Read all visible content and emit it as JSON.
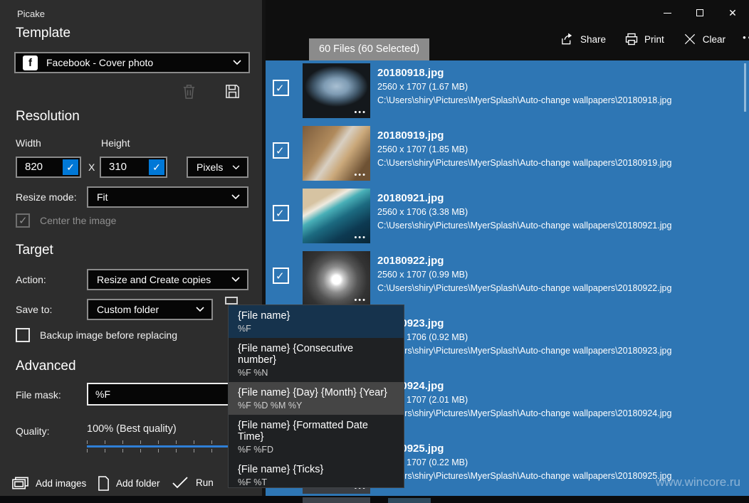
{
  "titlebar": {
    "app_title": "Picake"
  },
  "template_section": {
    "heading": "Template",
    "dropdown_value": "Facebook - Cover photo"
  },
  "resolution_section": {
    "heading": "Resolution",
    "width_label": "Width",
    "height_label": "Height",
    "width_value": "820",
    "height_value": "310",
    "separator": "X",
    "unit_value": "Pixels",
    "resize_mode_label": "Resize mode:",
    "resize_mode_value": "Fit",
    "center_checkbox_label": "Center the image",
    "center_checkbox_checked": true,
    "center_checkbox_disabled": true
  },
  "target_section": {
    "heading": "Target",
    "action_label": "Action:",
    "action_value": "Resize and Create copies",
    "save_to_label": "Save to:",
    "save_to_value": "Custom folder",
    "backup_checkbox_label": "Backup image before replacing",
    "backup_checkbox_checked": false
  },
  "advanced_section": {
    "heading": "Advanced",
    "file_mask_label": "File mask:",
    "file_mask_value": "%F",
    "quality_label": "Quality:",
    "quality_value": "100% (Best quality)"
  },
  "footer": {
    "add_images_label": "Add images",
    "add_folder_label": "Add folder",
    "run_label": "Run"
  },
  "file_mask_menu": {
    "items": [
      {
        "label": "{File name}",
        "code": "%F",
        "state": "selected"
      },
      {
        "label": "{File name} {Consecutive number}",
        "code": "%F %N",
        "state": "normal"
      },
      {
        "label": "{File name} {Day} {Month} {Year}",
        "code": "%F %D %M %Y",
        "state": "hover"
      },
      {
        "label": "{File name} {Formatted Date Time}",
        "code": "%F %FD",
        "state": "normal"
      },
      {
        "label": "{File name} {Ticks}",
        "code": "%F %T",
        "state": "normal"
      }
    ]
  },
  "file_list": {
    "count_badge": "60 Files (60 Selected)",
    "toolbar": {
      "share": "Share",
      "print": "Print",
      "clear": "Clear",
      "more": "•••"
    },
    "rows": [
      {
        "name": "20180918.jpg",
        "meta": "2560 x 1707 (1.67 MB)",
        "path": "C:\\Users\\shiry\\Pictures\\MyerSplash\\Auto-change wallpapers\\20180918.jpg",
        "thumb": "cave",
        "checked": true
      },
      {
        "name": "20180919.jpg",
        "meta": "2560 x 1707 (1.85 MB)",
        "path": "C:\\Users\\shiry\\Pictures\\MyerSplash\\Auto-change wallpapers\\20180919.jpg",
        "thumb": "desk",
        "checked": true
      },
      {
        "name": "20180921.jpg",
        "meta": "2560 x 1706 (3.38 MB)",
        "path": "C:\\Users\\shiry\\Pictures\\MyerSplash\\Auto-change wallpapers\\20180921.jpg",
        "thumb": "beach",
        "checked": true
      },
      {
        "name": "20180922.jpg",
        "meta": "2560 x 1707 (0.99 MB)",
        "path": "C:\\Users\\shiry\\Pictures\\MyerSplash\\Auto-change wallpapers\\20180922.jpg",
        "thumb": "spiral",
        "checked": true
      },
      {
        "name": "20180923.jpg",
        "meta": "2560 x 1706 (0.92 MB)",
        "path": "C:\\Users\\shiry\\Pictures\\MyerSplash\\Auto-change wallpapers\\20180923.jpg",
        "thumb": "dark",
        "checked": true
      },
      {
        "name": "20180924.jpg",
        "meta": "2560 x 1707 (2.01 MB)",
        "path": "C:\\Users\\shiry\\Pictures\\MyerSplash\\Auto-change wallpapers\\20180924.jpg",
        "thumb": "dark",
        "checked": true
      },
      {
        "name": "20180925.jpg",
        "meta": "2560 x 1707 (0.22 MB)",
        "path": "C:\\Users\\shiry\\Pictures\\MyerSplash\\Auto-change wallpapers\\20180925.jpg",
        "thumb": "dark",
        "checked": true
      }
    ]
  },
  "watermark": "www.wincore.ru",
  "colors": {
    "accent_blue": "#0078d7",
    "selection_blue": "#2e76b4",
    "quality_slider_blue": "#2f7fd6",
    "menu_selected_navy": "#16334d",
    "panel_gray": "#2d2d2d"
  }
}
